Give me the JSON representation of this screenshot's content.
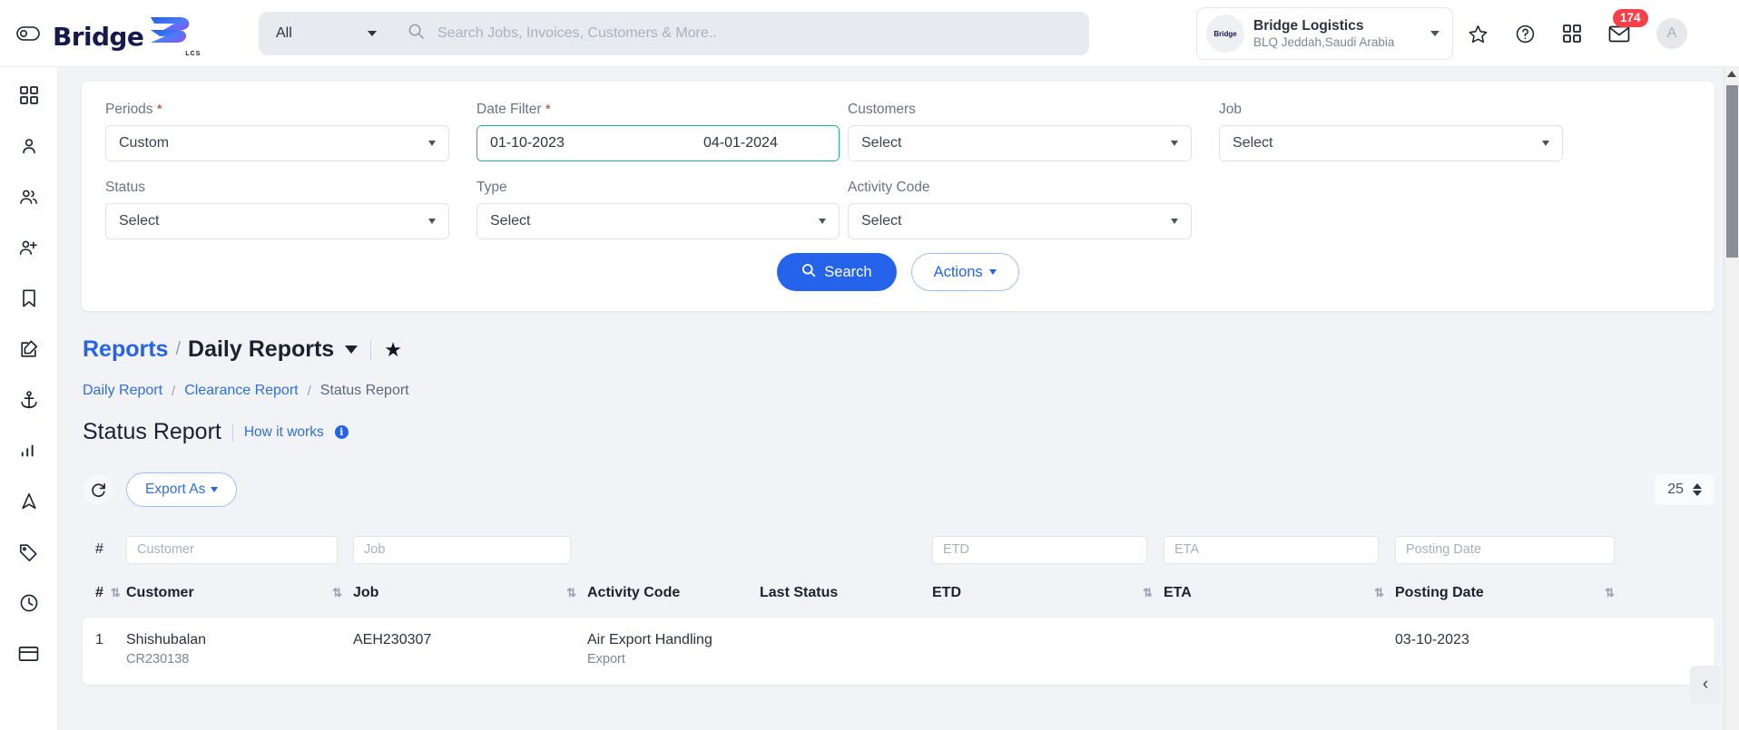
{
  "header": {
    "logo_text": "Bridge",
    "logo_sub": "LCS",
    "search_scope": "All",
    "search_placeholder": "Search Jobs, Invoices, Customers & More..",
    "search_value": "",
    "org_badge": "Bridge",
    "org_name": "Bridge Logistics",
    "org_location": "BLQ Jeddah,Saudi Arabia",
    "icons": {
      "star": "star-icon",
      "help": "help-icon",
      "apps": "apps-grid-icon",
      "mail": "mail-icon",
      "mail_badge": "174",
      "avatar_initial": "A"
    }
  },
  "sidebar": {
    "items": [
      {
        "name": "dashboard",
        "icon": "grid-icon"
      },
      {
        "name": "profile",
        "icon": "user-icon"
      },
      {
        "name": "customers",
        "icon": "users-icon"
      },
      {
        "name": "add-user",
        "icon": "user-add-icon"
      },
      {
        "name": "bookmarks",
        "icon": "bookmark-icon"
      },
      {
        "name": "edit",
        "icon": "edit-square-icon"
      },
      {
        "name": "shipping",
        "icon": "anchor-icon"
      },
      {
        "name": "reports",
        "icon": "bar-chart-icon"
      },
      {
        "name": "tracking",
        "icon": "navigation-icon"
      },
      {
        "name": "tags",
        "icon": "tag-icon"
      },
      {
        "name": "history",
        "icon": "clock-icon"
      },
      {
        "name": "billing",
        "icon": "card-icon"
      }
    ]
  },
  "filters": {
    "periods": {
      "label": "Periods",
      "required": true,
      "value": "Custom"
    },
    "date_filter": {
      "label": "Date Filter",
      "required": true,
      "from": "01-10-2023",
      "to": "04-01-2024"
    },
    "customers": {
      "label": "Customers",
      "value": "Select"
    },
    "job": {
      "label": "Job",
      "value": "Select"
    },
    "status": {
      "label": "Status",
      "value": "Select"
    },
    "type": {
      "label": "Type",
      "value": "Select"
    },
    "activity_code": {
      "label": "Activity Code",
      "value": "Select"
    },
    "search_button": "Search",
    "actions_button": "Actions"
  },
  "breadcrumb": {
    "root": "Reports",
    "sep": "/",
    "current": "Daily Reports"
  },
  "subcrumbs": [
    {
      "label": "Daily Report",
      "active": false
    },
    {
      "label": "Clearance Report",
      "active": false
    },
    {
      "label": "Status Report",
      "active": true
    }
  ],
  "page": {
    "title": "Status Report",
    "how_it_works": "How it works"
  },
  "toolbar": {
    "refresh_icon": "refresh-icon",
    "export_label": "Export As",
    "page_size": "25"
  },
  "table": {
    "columns": [
      {
        "key": "num",
        "header": "#",
        "filter": "",
        "sortable": true
      },
      {
        "key": "cust",
        "header": "Customer",
        "filter": "Customer",
        "sortable": true
      },
      {
        "key": "job",
        "header": "Job",
        "filter": "Job",
        "sortable": true
      },
      {
        "key": "act",
        "header": "Activity Code",
        "filter": "",
        "sortable": false
      },
      {
        "key": "stat",
        "header": "Last Status",
        "filter": "",
        "sortable": false
      },
      {
        "key": "etd",
        "header": "ETD",
        "filter": "ETD",
        "sortable": true
      },
      {
        "key": "eta",
        "header": "ETA",
        "filter": "ETA",
        "sortable": true
      },
      {
        "key": "post",
        "header": "Posting Date",
        "filter": "Posting Date",
        "sortable": true
      }
    ],
    "rows": [
      {
        "num": "1",
        "customer": "Shishubalan",
        "customer_code": "CR230138",
        "job": "AEH230307",
        "activity_code": "Air Export Handling",
        "activity_type": "Export",
        "last_status": "",
        "etd": "",
        "eta": "",
        "posting_date": "03-10-2023"
      }
    ]
  },
  "colors": {
    "primary": "#2563eb",
    "date_border": "#25b28a",
    "badge_red": "#f5424a",
    "logo_navy": "#151a4a",
    "page_bg": "#f1f3f6"
  }
}
